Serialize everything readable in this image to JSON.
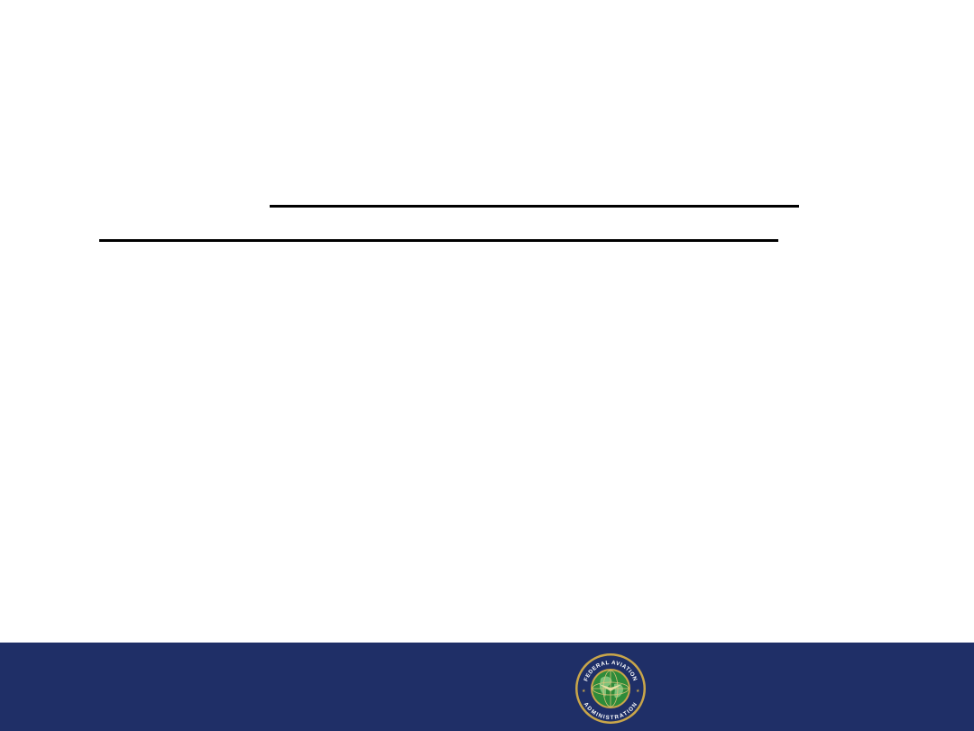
{
  "slide": {
    "background_color": "#ffffff",
    "rule_color": "#000000"
  },
  "footer": {
    "background_color": "#1f2f67",
    "seal": {
      "icon": "faa-seal-icon",
      "text_top": "FEDERAL AVIATION",
      "text_bottom": "ADMINISTRATION",
      "ring_color": "#1f2f67",
      "border_color": "#c9a64a",
      "globe_color": "#2e8b3a"
    }
  }
}
